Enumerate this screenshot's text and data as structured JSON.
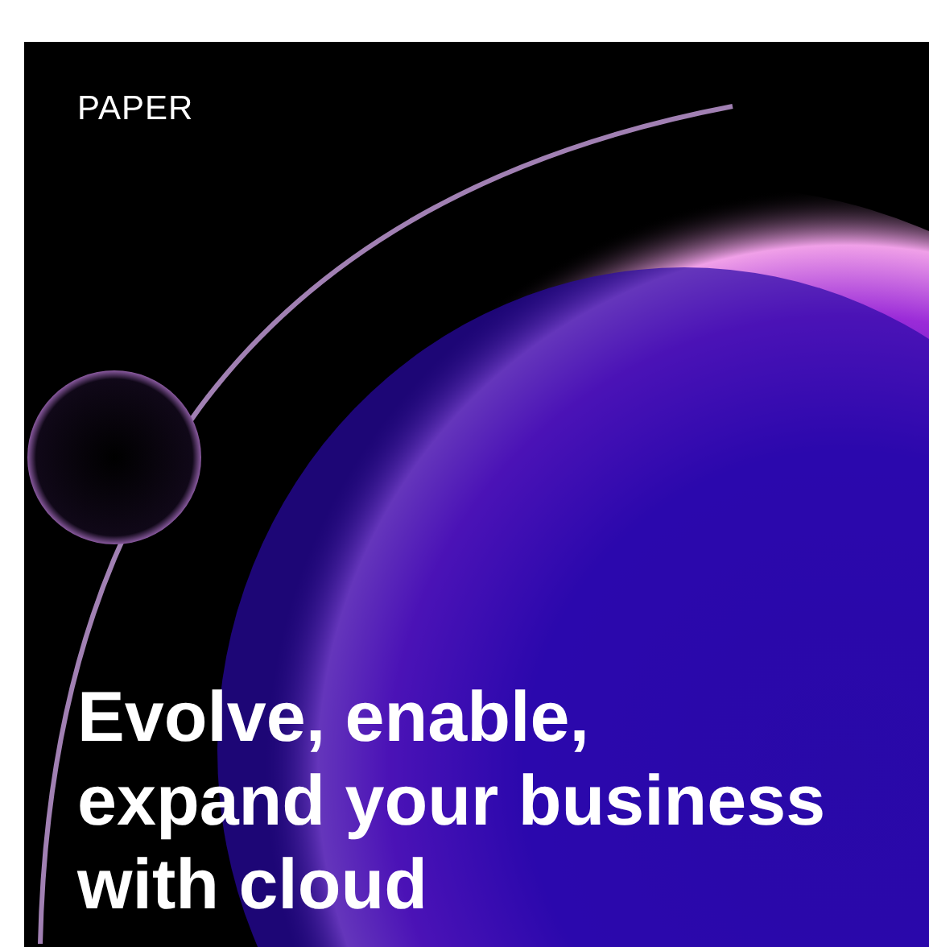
{
  "card": {
    "label": "PAPER",
    "headline": [
      "Evolve, enable,",
      "expand your business",
      "with cloud"
    ]
  }
}
